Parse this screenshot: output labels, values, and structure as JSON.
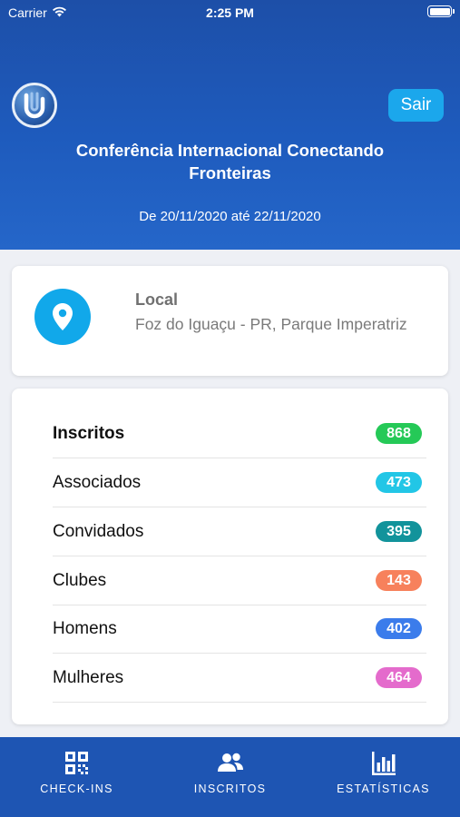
{
  "status_bar": {
    "carrier": "Carrier",
    "time": "2:25 PM"
  },
  "header": {
    "logout_label": "Sair",
    "title": "Conferência Internacional Conectando Fronteiras",
    "dates": "De 20/11/2020 até 22/11/2020"
  },
  "location": {
    "label": "Local",
    "address": "Foz do Iguaçu - PR, Parque Imperatriz",
    "icon": "map-pin-icon"
  },
  "stats": [
    {
      "label": "Inscritos",
      "value": "868",
      "color": "#25c957"
    },
    {
      "label": "Associados",
      "value": "473",
      "color": "#22c6e6"
    },
    {
      "label": "Convidados",
      "value": "395",
      "color": "#12939b"
    },
    {
      "label": "Clubes",
      "value": "143",
      "color": "#f7815c"
    },
    {
      "label": "Homens",
      "value": "402",
      "color": "#3b7ceb"
    },
    {
      "label": "Mulheres",
      "value": "464",
      "color": "#e46bcc"
    }
  ],
  "tabs": [
    {
      "label": "CHECK-INS",
      "icon": "qr-code-icon"
    },
    {
      "label": "INSCRITOS",
      "icon": "users-icon"
    },
    {
      "label": "ESTATÍSTICAS",
      "icon": "bar-chart-icon"
    }
  ],
  "colors": {
    "header_blue": "#1e5bbd",
    "accent": "#1ba7ec",
    "tabbar": "#1e55b3"
  }
}
